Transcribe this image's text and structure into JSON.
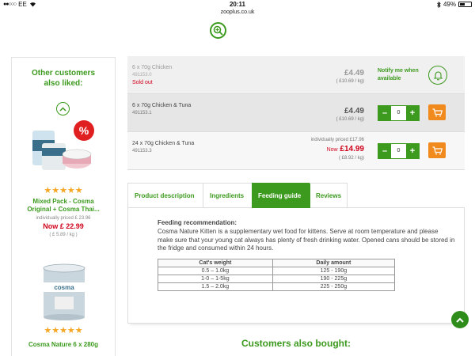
{
  "status_bar": {
    "carrier": "EE",
    "time": "20:11",
    "battery_percent": "49%",
    "battery_level": 0.49
  },
  "url": "zooplus.co.uk",
  "sidebar": {
    "title_line1": "Other customers",
    "title_line2": "also liked:",
    "products": [
      {
        "name_line1": "Mixed Pack - Cosma",
        "name_line2": "Original + Cosma Thai...",
        "individually_priced": "individually priced £ 23.96",
        "now_price": "Now £ 22.99",
        "per_kg": "( £ 5.89 / kg )",
        "rating_stars": 5
      },
      {
        "name_line1": "Cosma Nature 6 x 280g",
        "rating_stars": 5
      }
    ]
  },
  "variants": [
    {
      "name": "6 x 70g Chicken",
      "sku": "491153.0",
      "status": "Sold out",
      "price": "£4.49",
      "per_kg": "( £10.69 / kg)",
      "notify_line1": "Notify me when",
      "notify_line2": "available"
    },
    {
      "name": "6 x 70g Chicken & Tuna",
      "sku": "491153.1",
      "price": "£4.49",
      "per_kg": "( £10.69 / kg)",
      "quantity": "0"
    },
    {
      "name": "24 x 70g Chicken & Tuna",
      "sku": "491153.3",
      "individually_priced": "individually priced £17.96",
      "now_label": "Now",
      "now_price": "£14.99",
      "per_kg": "( £8.92 / kg)",
      "quantity": "0"
    }
  ],
  "stepper": {
    "minus": "–",
    "plus": "+"
  },
  "tabs": [
    {
      "label": "Product description",
      "active": false
    },
    {
      "label": "Ingredients",
      "active": false
    },
    {
      "label": "Feeding guide",
      "active": true
    },
    {
      "label": "Reviews",
      "active": false
    }
  ],
  "feeding": {
    "heading": "Feeding recommendation:",
    "text": "Cosma Nature Kitten is a supplementary wet food for kittens. Serve at room temperature and please make sure that your young cat always has plenty of fresh drinking water. Opened cans should be stored in the fridge and consumed within 24 hours.",
    "table_headers": [
      "Cat's weight",
      "Daily amount"
    ],
    "table_rows": [
      [
        "0.5 – 1.0kg",
        "125 - 190g"
      ],
      [
        "1-0 – 1-5kg",
        "190 - 225g"
      ],
      [
        "1.5 – 2.0kg",
        "225 - 250g"
      ]
    ]
  },
  "also_bought_title": "Customers also bought:",
  "colors": {
    "brand_green": "#3c9a1e",
    "price_red": "#d0021b",
    "cart_orange": "#f08a1d",
    "star_gold": "#f5a623"
  },
  "icons": [
    "wifi-icon",
    "bluetooth-icon",
    "zoom-icon",
    "bell-icon",
    "cart-icon",
    "chevron-up-icon"
  ]
}
